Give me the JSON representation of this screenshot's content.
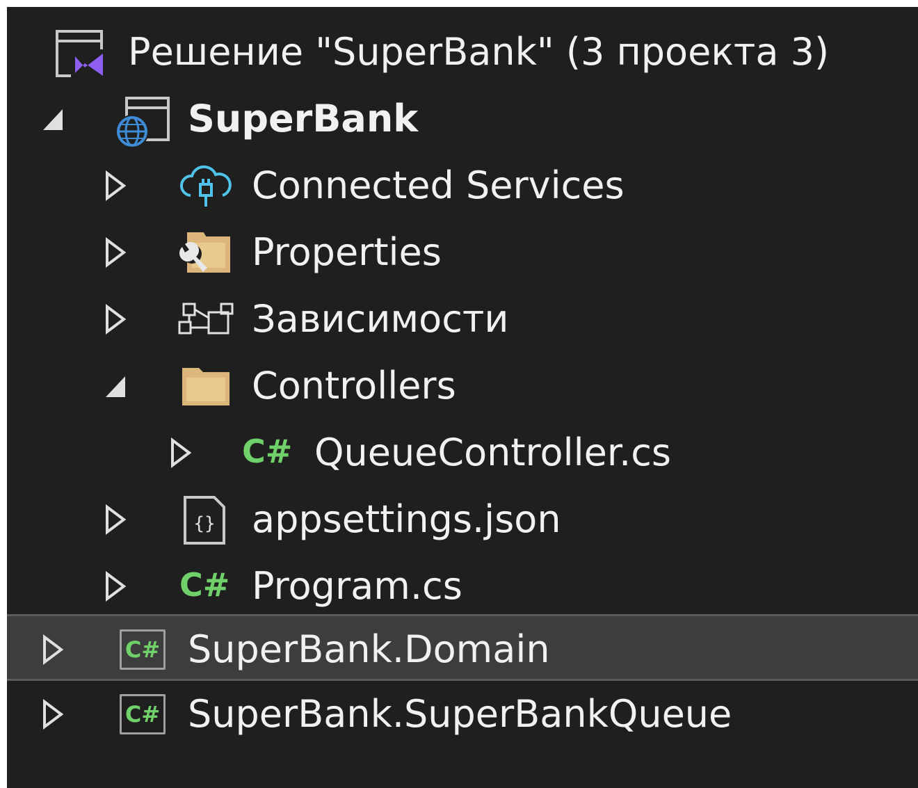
{
  "solution": {
    "label": "Решение \"SuperBank\"  (3 проекта 3)",
    "icon": "visual-studio-solution-icon"
  },
  "project": {
    "label": "SuperBank",
    "icon": "web-project-icon"
  },
  "items": [
    {
      "label": "Connected Services",
      "icon": "connected-services-icon"
    },
    {
      "label": "Properties",
      "icon": "properties-folder-icon"
    },
    {
      "label": "Зависимости",
      "icon": "dependencies-icon"
    },
    {
      "label": "Controllers",
      "icon": "folder-icon"
    },
    {
      "label": "QueueController.cs",
      "icon": "csharp-file-icon",
      "glyph": "C#"
    },
    {
      "label": "appsettings.json",
      "icon": "json-file-icon"
    },
    {
      "label": "Program.cs",
      "icon": "csharp-file-icon",
      "glyph": "C#"
    }
  ],
  "projects": [
    {
      "label": "SuperBank.Domain",
      "icon": "csharp-project-icon",
      "glyph": "C#",
      "selected": true
    },
    {
      "label": "SuperBank.SuperBankQueue",
      "icon": "csharp-project-icon",
      "glyph": "C#",
      "selected": false
    }
  ],
  "colors": {
    "background": "#1f1f1f",
    "text": "#f1f1f1",
    "csharp": "#70d16b",
    "folder": "#dcb67a",
    "selection": "#3d3d3d",
    "vs_purple": "#8f5ef2",
    "globe_blue": "#3e8bd6",
    "cloud_cyan": "#4fc3e8"
  }
}
